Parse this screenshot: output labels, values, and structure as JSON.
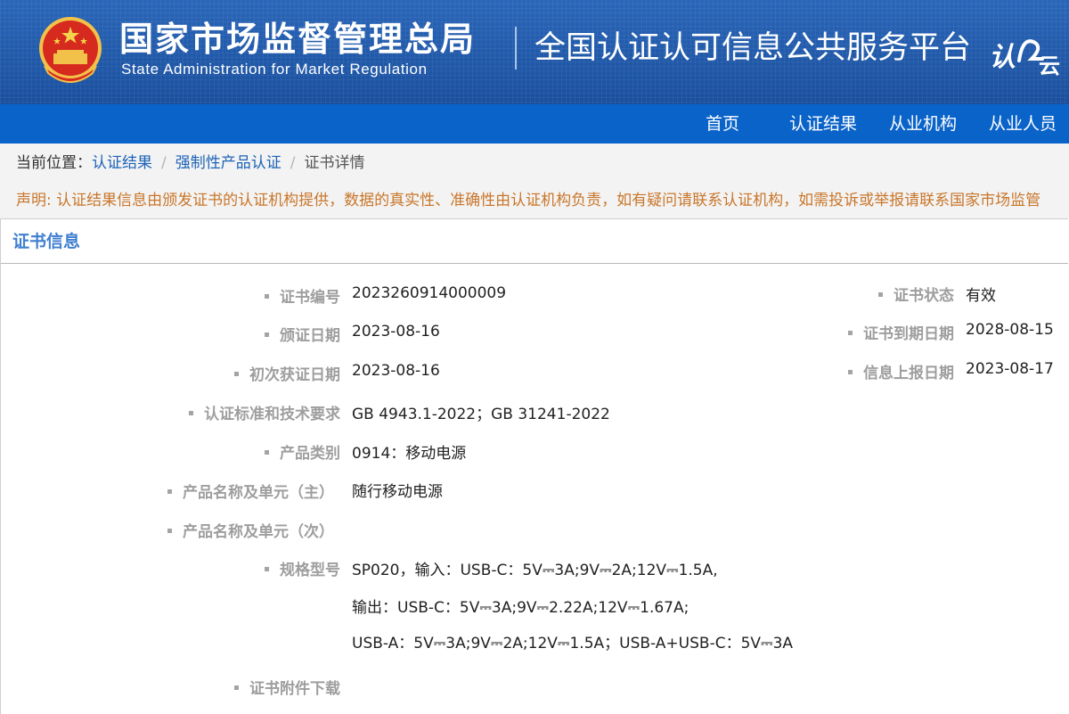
{
  "header": {
    "agency_cn": "国家市场监督管理总局",
    "agency_en": "State Administration  for  Market Regulation",
    "platform_title": "全国认证认可信息公共服务平台",
    "logo_text": "认云",
    "colors": {
      "banner": "#1f58a8",
      "nav": "#0a63c9",
      "accent_link": "#1c63b7",
      "notice": "#c9762a"
    }
  },
  "nav": {
    "items": [
      "首页",
      "认证结果",
      "从业机构",
      "从业人员"
    ]
  },
  "breadcrumb": {
    "prefix": "当前位置：",
    "items": [
      "认证结果",
      "强制性产品认证",
      "证书详情"
    ]
  },
  "notice": {
    "text": "声明: 认证结果信息由颁发证书的认证机构提供，数据的真实性、准确性由认证机构负责，如有疑问请联系认证机构，如需投诉或举报请联系国家市场监管"
  },
  "panel": {
    "title": "证书信息"
  },
  "fields_left": {
    "cert_no": {
      "label": "证书编号",
      "value": "2023260914000009"
    },
    "issue_date": {
      "label": "颁证日期",
      "value": "2023-08-16"
    },
    "first_date": {
      "label": "初次获证日期",
      "value": "2023-08-16"
    },
    "standards": {
      "label": "认证标准和技术要求",
      "value": "GB 4943.1-2022；GB 31241-2022"
    },
    "category": {
      "label": "产品类别",
      "value": "0914：移动电源"
    },
    "product_main": {
      "label": "产品名称及单元（主）",
      "value": "随行移动电源"
    },
    "product_sub": {
      "label": "产品名称及单元（次）",
      "value": ""
    },
    "model": {
      "label": "规格型号",
      "line1": "SP020，输入：USB-C：5V⎓3A;9V⎓2A;12V⎓1.5A,",
      "line2": "输出：USB-C：5V⎓3A;9V⎓2.22A;12V⎓1.67A;",
      "line3": "USB-A：5V⎓3A;9V⎓2A;12V⎓1.5A；USB-A+USB-C：5V⎓3A"
    },
    "attachment": {
      "label": "证书附件下载"
    }
  },
  "fields_right": {
    "status": {
      "label": "证书状态",
      "value": "有效"
    },
    "expiry": {
      "label": "证书到期日期",
      "value": "2028-08-15"
    },
    "report_date": {
      "label": "信息上报日期",
      "value": "2023-08-17"
    }
  }
}
